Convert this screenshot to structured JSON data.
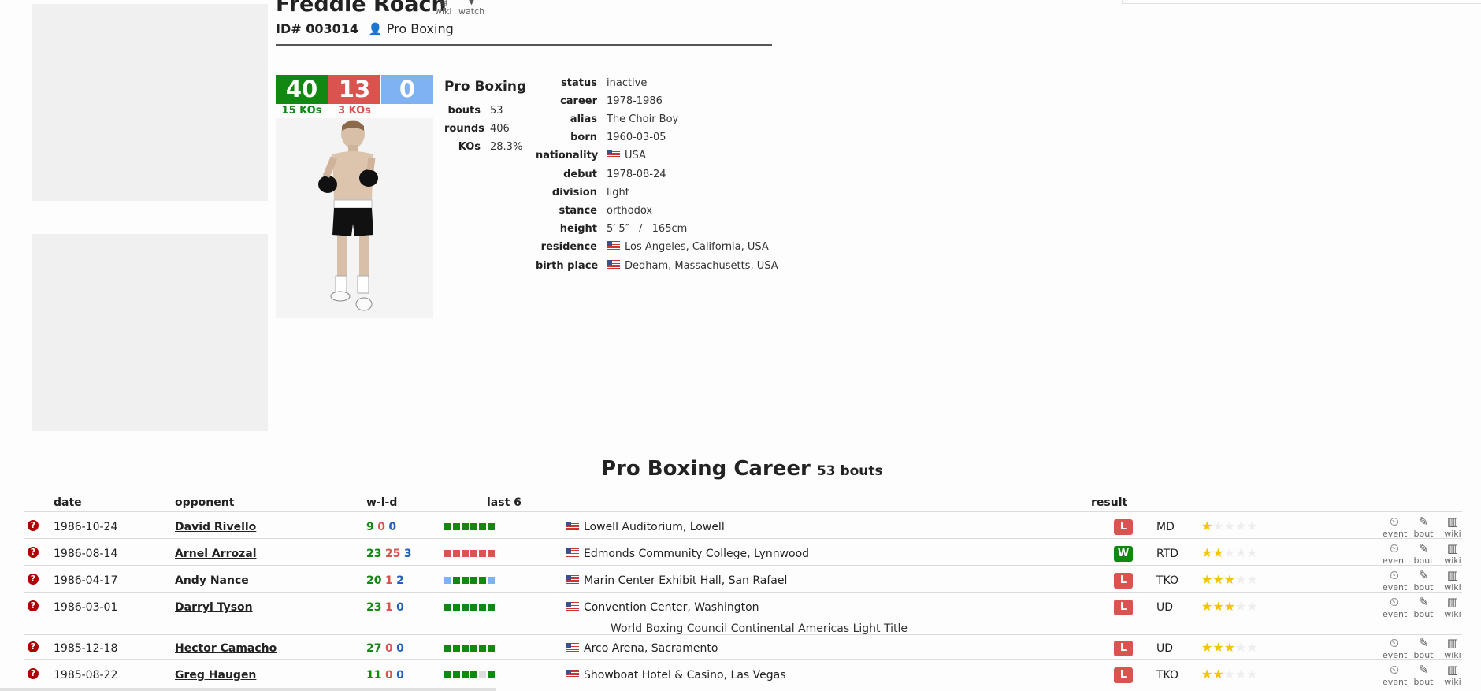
{
  "header": {
    "name": "Freddie Roach",
    "wiki_label": "wiki",
    "watch_label": "watch",
    "id_label": "ID# 003014",
    "sport": "Pro Boxing"
  },
  "record": {
    "wins": "40",
    "losses": "13",
    "draws": "0",
    "win_kos": "15 KOs",
    "loss_kos": "3 KOs",
    "colors": {
      "win": "#118811",
      "loss": "#d9534f",
      "draw": "#7fb2f0"
    }
  },
  "summary": {
    "title": "Pro Boxing",
    "rows": [
      {
        "k": "bouts",
        "v": "53"
      },
      {
        "k": "rounds",
        "v": "406"
      },
      {
        "k": "KOs",
        "v": "28.3%"
      }
    ]
  },
  "bio": [
    {
      "k": "status",
      "v": "inactive",
      "flag": false
    },
    {
      "k": "career",
      "v": "1978-1986",
      "flag": false
    },
    {
      "k": "alias",
      "v": "The Choir Boy",
      "flag": false
    },
    {
      "k": "born",
      "v": "1960-03-05",
      "flag": false
    },
    {
      "k": "nationality",
      "v": "USA",
      "flag": true
    },
    {
      "k": "debut",
      "v": "1978-08-24",
      "flag": false
    },
    {
      "k": "division",
      "v": "light",
      "flag": false
    },
    {
      "k": "stance",
      "v": "orthodox",
      "flag": false
    },
    {
      "k": "height",
      "v": "5′ 5″   /   165cm",
      "flag": false
    },
    {
      "k": "residence",
      "v": "Los Angeles, California, USA",
      "flag": true
    },
    {
      "k": "birth place",
      "v": "Dedham, Massachusetts, USA",
      "flag": true
    }
  ],
  "career": {
    "title": "Pro Boxing Career",
    "bouts_label": "53 bouts",
    "headers": {
      "date": "date",
      "opponent": "opponent",
      "wld": "w-l-d",
      "last6": "last 6",
      "result": "result"
    },
    "action_labels": {
      "event": "event",
      "bout": "bout",
      "wiki": "wiki"
    },
    "bouts": [
      {
        "date": "1986-10-24",
        "opponent": "David Rivello",
        "w": "9",
        "l": "0",
        "d": "0",
        "last6": [
          "w",
          "w",
          "w",
          "w",
          "w",
          "w"
        ],
        "venue": "Lowell Auditorium, Lowell",
        "result": "L",
        "method": "MD",
        "stars": 1,
        "note": ""
      },
      {
        "date": "1986-08-14",
        "opponent": "Arnel Arrozal",
        "w": "23",
        "l": "25",
        "d": "3",
        "last6": [
          "l",
          "l",
          "l",
          "l",
          "l",
          "l"
        ],
        "venue": "Edmonds Community College, Lynnwood",
        "result": "W",
        "method": "RTD",
        "stars": 2,
        "note": ""
      },
      {
        "date": "1986-04-17",
        "opponent": "Andy Nance",
        "w": "20",
        "l": "1",
        "d": "2",
        "last6": [
          "d",
          "w",
          "w",
          "w",
          "w",
          "d"
        ],
        "venue": "Marin Center Exhibit Hall, San Rafael",
        "result": "L",
        "method": "TKO",
        "stars": 3,
        "note": ""
      },
      {
        "date": "1986-03-01",
        "opponent": "Darryl Tyson",
        "w": "23",
        "l": "1",
        "d": "0",
        "last6": [
          "w",
          "w",
          "w",
          "w",
          "w",
          "w"
        ],
        "venue": "Convention Center, Washington",
        "result": "L",
        "method": "UD",
        "stars": 3,
        "note": "World Boxing Council Continental Americas Light Title"
      },
      {
        "date": "1985-12-18",
        "opponent": "Hector Camacho",
        "w": "27",
        "l": "0",
        "d": "0",
        "last6": [
          "w",
          "w",
          "w",
          "w",
          "w",
          "w"
        ],
        "venue": "Arco Arena, Sacramento",
        "result": "L",
        "method": "UD",
        "stars": 3,
        "note": ""
      },
      {
        "date": "1985-08-22",
        "opponent": "Greg Haugen",
        "w": "11",
        "l": "0",
        "d": "0",
        "last6": [
          "w",
          "w",
          "w",
          "w",
          "n",
          "w"
        ],
        "venue": "Showboat Hotel & Casino, Las Vegas",
        "result": "L",
        "method": "TKO",
        "stars": 2,
        "note": ""
      }
    ]
  }
}
